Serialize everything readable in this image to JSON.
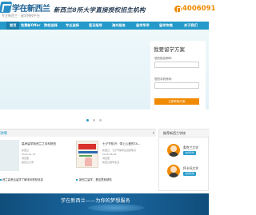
{
  "header": {
    "logo_name": "学在新西兰",
    "logo_sub": "专注新西兰 · 留学择校平台",
    "slogan": "新西兰8所大学直接授权招生机构",
    "hotline": "4006091"
  },
  "nav": {
    "items": [
      "首页",
      "免费新Offer",
      "院校选择",
      "专业选择",
      "签证指导",
      "海外服务",
      "留学早早",
      "留学攻略",
      "关于我们"
    ]
  },
  "apply": {
    "title": "我要留学方案",
    "name_label": "您的姓名称呼：",
    "name_placeholder": "",
    "phone_label": "您的手机号码：",
    "phone_placeholder": "",
    "submit": "立即获取方案"
  },
  "strategy": {
    "label": "攻略",
    "more": "›"
  },
  "articles": [
    {
      "title": "高考留学新西兰之本科院校",
      "meta": [
        "新西兰",
        "2024-01-15",
        "浏览量",
        "奥克兰大学"
      ],
      "link": "西兰高考后留学了解本科院校信息"
    },
    {
      "title": "七夕节知识：带上心爱的TA...",
      "meta": [
        "新西兰：七夕节留学生活的知识",
        "2024-08-08",
        "浏览量",
        "新西兰留学生活"
      ],
      "link": "新西兰留学，看这里就够啦"
    }
  ],
  "advisors": {
    "title": "推荐新西兰学校",
    "people": [
      {
        "name": "奥克兰大学",
        "button": "在线咨询"
      },
      {
        "name": "怀卡托大学",
        "button": "在线咨询"
      }
    ]
  },
  "footer": {
    "tagline": "学在新西兰——为你的梦想服务"
  },
  "colors": {
    "brand_blue": "#2599c9",
    "accent_orange": "#f08a00",
    "footer_navy": "#0f4d7b"
  }
}
